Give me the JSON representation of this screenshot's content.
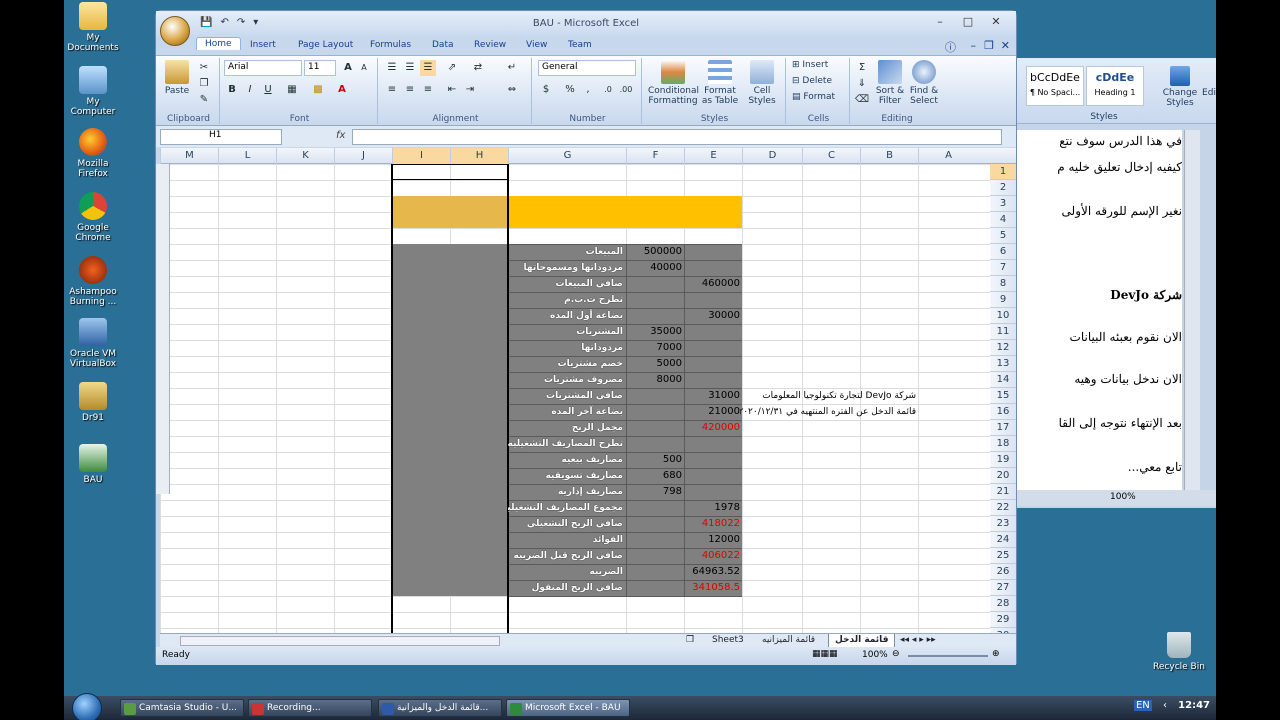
{
  "desktop": {
    "icons": [
      "My Documents",
      "My Computer",
      "Mozilla Firefox",
      "Google Chrome",
      "Ashampoo Burning ...",
      "Oracle VM VirtualBox",
      "Dr91",
      "BAU"
    ],
    "recycle_bin": "Recycle Bin"
  },
  "word": {
    "styles": [
      {
        "sample": "bCcDdEe",
        "name": "¶ No Spaci..."
      },
      {
        "sample": "cDdEe",
        "name": "Heading 1"
      }
    ],
    "change_styles": "Change Styles",
    "styles_group": "Styles",
    "edit": "Edi",
    "doc_lines": [
      "في هذا الدرس سوف نتع",
      "كيفيه إدخال تعليق خليه م",
      "نغير الإسم للورقه الأولى",
      "شركة DevJo",
      "الان نقوم بعبئه البيانات",
      "الان ندخل بيانات وهيه",
      "بعد الإنتهاء نتوجه إلى القا",
      "تابع معي..."
    ],
    "zoom": "100%"
  },
  "excel": {
    "title": "BAU - Microsoft Excel",
    "tabs": [
      "Home",
      "Insert",
      "Page Layout",
      "Formulas",
      "Data",
      "Review",
      "View",
      "Team"
    ],
    "ribbon": {
      "paste": "Paste",
      "clipboard": "Clipboard",
      "font_name": "Arial",
      "font_size": "11",
      "font_group": "Font",
      "alignment_group": "Alignment",
      "number_format": "General",
      "number_group": "Number",
      "conditional": "Conditional Formatting",
      "format_table": "Format as Table",
      "cell_styles": "Cell Styles",
      "styles_group": "Styles",
      "insert": "Insert",
      "delete": "Delete",
      "format": "Format",
      "cells_group": "Cells",
      "sort": "Sort & Filter",
      "find": "Find & Select",
      "editing_group": "Editing"
    },
    "name_box": "H1",
    "fx": "fx",
    "columns": [
      "M",
      "L",
      "K",
      "J",
      "I",
      "H",
      "G",
      "F",
      "E",
      "D",
      "C",
      "B",
      "A"
    ],
    "rows": [
      "1",
      "2",
      "3",
      "4",
      "5",
      "6",
      "7",
      "8",
      "9",
      "10",
      "11",
      "12",
      "13",
      "14",
      "15",
      "16",
      "17",
      "18",
      "19",
      "20",
      "21",
      "22",
      "23",
      "24",
      "25",
      "26",
      "27",
      "28",
      "29",
      "30"
    ],
    "statement": [
      {
        "row": 6,
        "label": "المبيعات",
        "f": "500000",
        "e": ""
      },
      {
        "row": 7,
        "label": "مردوداتها ومسموحاتها",
        "f": "40000",
        "e": ""
      },
      {
        "row": 8,
        "label": "صافي المبيعات",
        "f": "",
        "e": "460000"
      },
      {
        "row": 9,
        "label": "تطرح ت.ب.م",
        "f": "",
        "e": ""
      },
      {
        "row": 10,
        "label": "بضاعة أول المده",
        "f": "",
        "e": "30000"
      },
      {
        "row": 11,
        "label": "المشتريات",
        "f": "35000",
        "e": ""
      },
      {
        "row": 12,
        "label": "مردوداتها",
        "f": "7000",
        "e": ""
      },
      {
        "row": 13,
        "label": "خصم مشتريات",
        "f": "5000",
        "e": ""
      },
      {
        "row": 14,
        "label": "مصروف مشتريات",
        "f": "8000",
        "e": ""
      },
      {
        "row": 15,
        "label": "صافي المشتريات",
        "f": "",
        "e": "31000"
      },
      {
        "row": 16,
        "label": "بضاعة آخر المده",
        "f": "",
        "e": "21000"
      },
      {
        "row": 17,
        "label": "مجمل الربح",
        "f": "",
        "e": "420000",
        "red": true
      },
      {
        "row": 18,
        "label": "تطرح المصاريف التشغيليه",
        "f": "",
        "e": ""
      },
      {
        "row": 19,
        "label": "مصاريف بيعيه",
        "f": "500",
        "e": ""
      },
      {
        "row": 20,
        "label": "مصاريف تسويقيه",
        "f": "680",
        "e": ""
      },
      {
        "row": 21,
        "label": "مصاريف إداريه",
        "f": "798",
        "e": ""
      },
      {
        "row": 22,
        "label": "مجموع المصاريف التشغيليه",
        "f": "",
        "e": "1978"
      },
      {
        "row": 23,
        "label": "صافي الربح التشغيلي",
        "f": "",
        "e": "418022",
        "red": true
      },
      {
        "row": 24,
        "label": "الفوائد",
        "f": "",
        "e": "12000"
      },
      {
        "row": 25,
        "label": "صافي الربح قبل الضريبه",
        "f": "",
        "e": "406022",
        "red": true
      },
      {
        "row": 26,
        "label": "الضريبه",
        "f": "",
        "e": "64963.52"
      },
      {
        "row": 27,
        "label": "صافي الربح المنقول",
        "f": "",
        "e": "341058.5",
        "red": true
      }
    ],
    "note_line1": "شركة DevJo لتجارة تكنولوجيا المعلومات",
    "note_line2": "قائمة الدخل عن الفتره المنتهيه في ٢٠٢٠/١٢/٣١",
    "sheets": [
      "قائمة الدخل",
      "قائمة الميزانيه",
      "Sheet3"
    ],
    "status": "Ready",
    "zoom": "100%",
    "colors": {
      "header_fill": "#ffc000",
      "i_fill": "#e6b84b",
      "table_fill": "#808080",
      "neg": "#e00000"
    }
  },
  "taskbar": {
    "items": [
      "Camtasia Studio - U...",
      "Recording...",
      "قائمة الدخل والميزانية...",
      "Microsoft Excel - BAU"
    ],
    "lang": "EN",
    "clock": "12:47"
  }
}
